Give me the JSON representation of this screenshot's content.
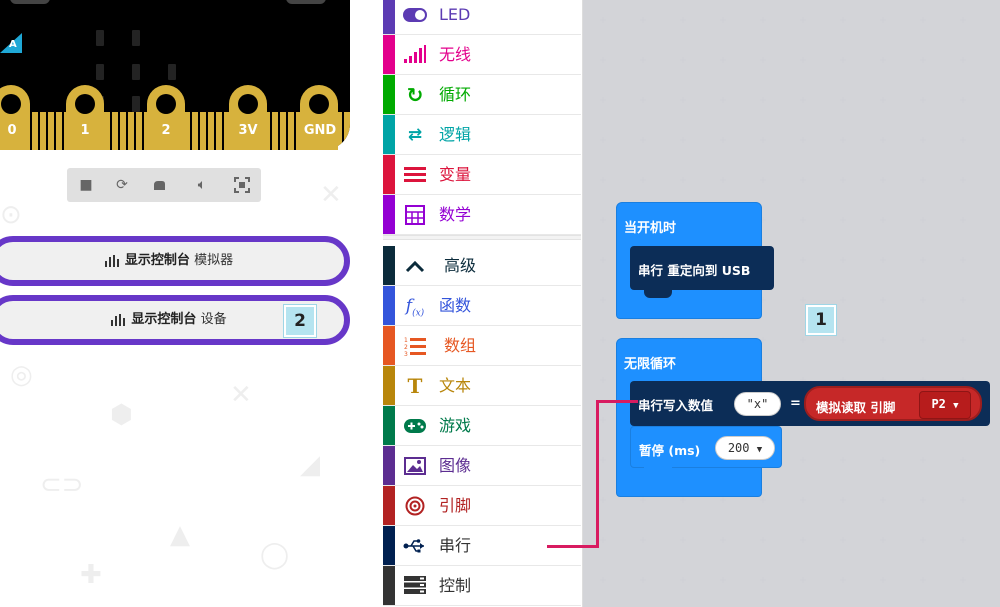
{
  "simulator": {
    "pins": [
      "0",
      "1",
      "2",
      "3V",
      "GND"
    ],
    "badge_letter": "A",
    "controls": [
      "stop-icon",
      "restart-icon",
      "slow-mo-icon",
      "mute-icon",
      "fullscreen-icon"
    ],
    "console_simulator": {
      "bold": "显示控制台",
      "rest": "模拟器"
    },
    "console_device": {
      "bold": "显示控制台",
      "rest": "设备"
    }
  },
  "toolbox": {
    "categories": [
      {
        "label": "LED",
        "icon": "toggle-icon",
        "color": "#5c3bb3"
      },
      {
        "label": "无线",
        "icon": "signal-bars-icon",
        "color": "#e3008c"
      },
      {
        "label": "循环",
        "icon": "loop-arrow-icon",
        "color": "#00aa00"
      },
      {
        "label": "逻辑",
        "icon": "shuffle-icon",
        "color": "#00a4a6"
      },
      {
        "label": "变量",
        "icon": "list-lines-icon",
        "color": "#dc143c"
      },
      {
        "label": "数学",
        "icon": "calculator-icon",
        "color": "#9400d3"
      },
      {
        "label": "高级",
        "icon": "chevron-up-icon",
        "color": "#0b2b3b"
      },
      {
        "label": "函数",
        "icon": "function-icon",
        "color": "#3455db"
      },
      {
        "label": "数组",
        "icon": "numbered-list-icon",
        "color": "#e65722"
      },
      {
        "label": "文本",
        "icon": "text-T-icon",
        "color": "#b8860b"
      },
      {
        "label": "游戏",
        "icon": "gamepad-icon",
        "color": "#007a4b"
      },
      {
        "label": "图像",
        "icon": "image-icon",
        "color": "#5c2d91"
      },
      {
        "label": "引脚",
        "icon": "target-icon",
        "color": "#b22222"
      },
      {
        "label": "串行",
        "icon": "usb-icon",
        "color": "#002050"
      },
      {
        "label": "控制",
        "icon": "server-icon",
        "color": "#333333"
      }
    ]
  },
  "workspace": {
    "on_start": {
      "label": "当开机时",
      "serial_block": "串行 重定向到 USB"
    },
    "forever": {
      "label": "无限循环"
    },
    "write_block": {
      "label": "串行写入数值",
      "name_value": "\"x\"",
      "equals": "="
    },
    "analog_read": {
      "label": "模拟读取 引脚",
      "pin": "P2"
    },
    "pause_block": {
      "label": "暂停 (ms)",
      "value": "200"
    },
    "annotation_1": "1",
    "annotation_2": "2"
  },
  "colors": {
    "accent_purple": "#6737c8",
    "block_blue": "#1e90ff",
    "serial_navy": "#0c2d57",
    "pins_red": "#c62828",
    "callout_magenta": "#d81b60",
    "badge_cyan": "#b5e4f0"
  }
}
